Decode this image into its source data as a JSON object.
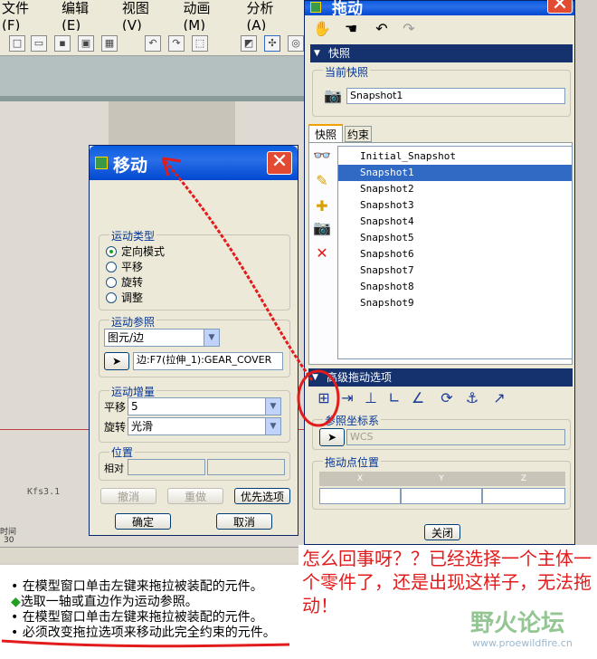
{
  "menu": [
    "文件(F)",
    "编辑(E)",
    "视图(V)",
    "动画(M)",
    "分析(A)"
  ],
  "viewport": {
    "label_kfs": "Kfs3.1",
    "timeline_label": "时间",
    "timeline_value": "30"
  },
  "status": [
    "在模型窗口单击左键来拖拉被装配的元件。",
    "选取一轴或直边作为运动参照。",
    "在模型窗口单击左键来拖拉被装配的元件。",
    "必须改变拖拉选项来移动此完全约束的元件。"
  ],
  "move_dialog": {
    "title": "移动",
    "motion_type": {
      "label": "运动类型",
      "options": [
        "定向模式",
        "平移",
        "旋转",
        "调整"
      ],
      "selected": 0
    },
    "motion_ref": {
      "label": "运动参照",
      "combo": "图元/边",
      "field": "边:F7(拉伸_1):GEAR_COVER"
    },
    "motion_inc": {
      "label": "运动增量",
      "translate_label": "平移",
      "translate_value": "5",
      "rotate_label": "旋转",
      "rotate_value": "光滑"
    },
    "position": {
      "label": "位置",
      "relative_label": "相对"
    },
    "undo": "撤消",
    "redo": "重做",
    "prefs": "优先选项",
    "ok": "确定",
    "cancel": "取消"
  },
  "drag_dialog": {
    "title": "拖动",
    "snapshot_header": "快照",
    "current_label": "当前快照",
    "current_value": "Snapshot1",
    "tabs": [
      "快照",
      "约束"
    ],
    "snapshots": [
      "Initial_Snapshot",
      "Snapshot1",
      "Snapshot2",
      "Snapshot3",
      "Snapshot4",
      "Snapshot5",
      "Snapshot6",
      "Snapshot7",
      "Snapshot8",
      "Snapshot9"
    ],
    "selected_snapshot": 1,
    "advanced_header": "高级拖动选项",
    "ref_coord_label": "参照坐标系",
    "ref_coord_value": "WCS",
    "drag_point_label": "拖动点位置",
    "coord_headers": [
      "X",
      "Y",
      "Z"
    ],
    "close": "关闭"
  },
  "annotation": "怎么回事呀？？已经选择一个主体一个零件了，还是出现这样子，无法拖动！",
  "watermark": {
    "cn": "野火论坛",
    "url": "www.proewildfire.cn"
  },
  "colors": {
    "title_blue": "#0a5ce0",
    "header_navy": "#16326e",
    "selection": "#316ac5",
    "annotation_red": "#e21c1c"
  }
}
